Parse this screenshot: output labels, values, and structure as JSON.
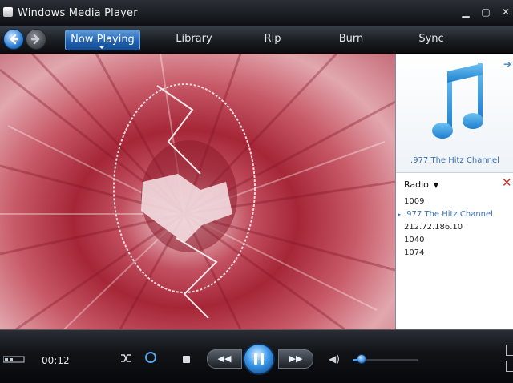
{
  "window": {
    "title": "Windows Media Player"
  },
  "nav": {
    "tabs": [
      {
        "label": "Now Playing",
        "active": true
      },
      {
        "label": "Library"
      },
      {
        "label": "Rip"
      },
      {
        "label": "Burn"
      },
      {
        "label": "Sync"
      }
    ]
  },
  "now_playing": {
    "station_title": ".977 The Hitz Channel",
    "list_header": "Radio",
    "items": [
      "1009",
      ".977 The Hitz Channel",
      "212.72.186.10",
      "1040",
      "1074"
    ],
    "current_index": 1
  },
  "player": {
    "elapsed": "00:12",
    "volume": 0.08
  },
  "colors": {
    "accent": "#2e7fd6",
    "visualization": "#b23445",
    "close": "#d3332b"
  },
  "icons": [
    "back-icon",
    "forward-icon",
    "music-note-icon",
    "close-icon",
    "shuffle-icon",
    "repeat-icon",
    "stop-icon",
    "previous-icon",
    "pause-icon",
    "next-icon",
    "speaker-icon"
  ]
}
